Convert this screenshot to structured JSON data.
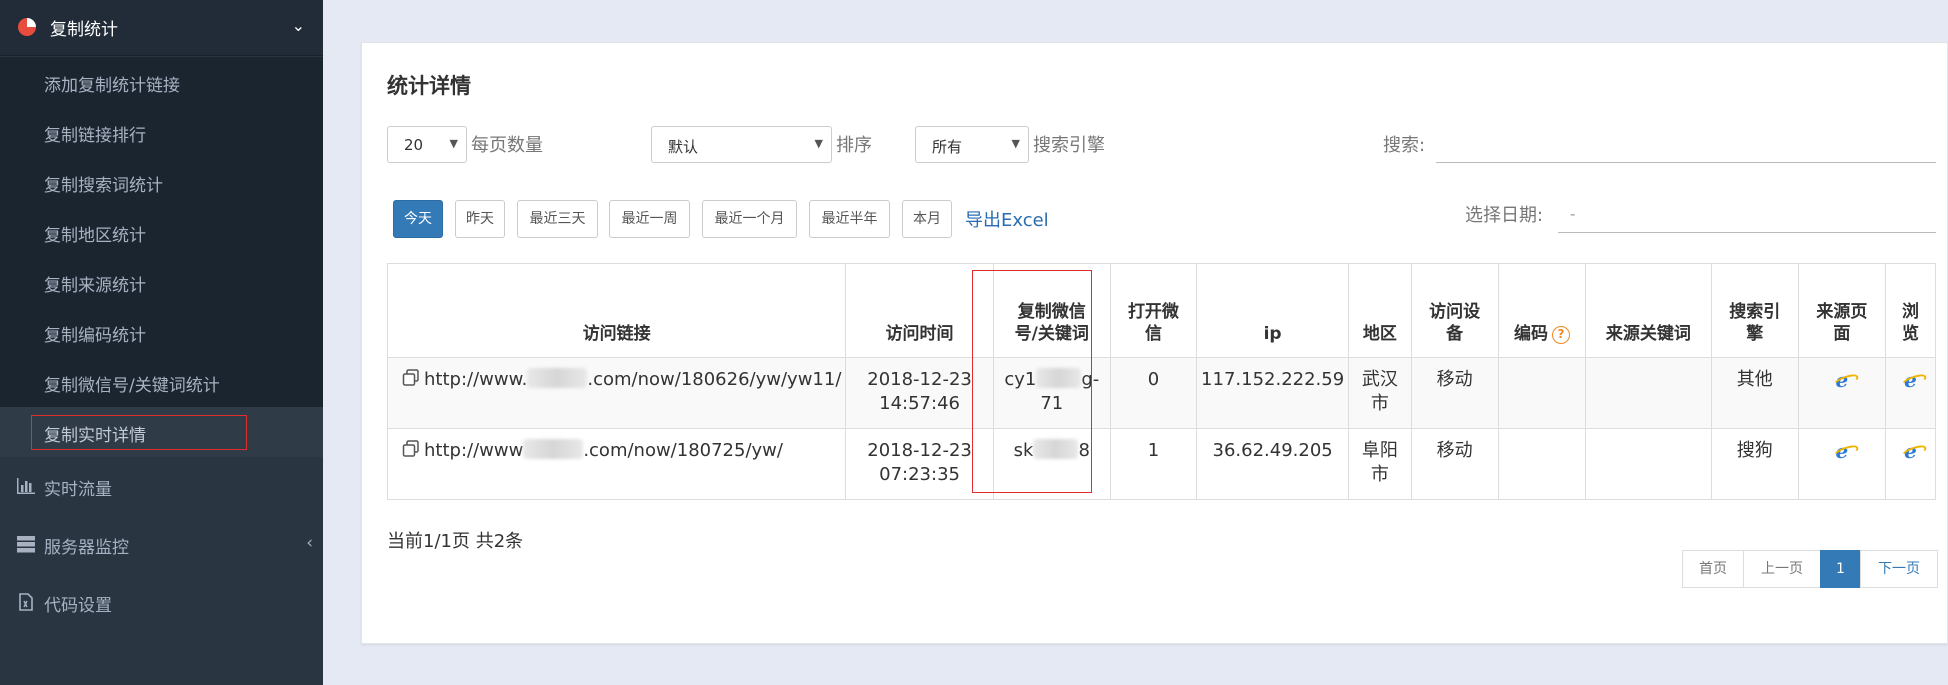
{
  "sidebar": {
    "header": {
      "title": "复制统计",
      "icon": "pie-chart-icon"
    },
    "submenu": [
      {
        "label": "添加复制统计链接"
      },
      {
        "label": "复制链接排行"
      },
      {
        "label": "复制搜索词统计"
      },
      {
        "label": "复制地区统计"
      },
      {
        "label": "复制来源统计"
      },
      {
        "label": "复制编码统计"
      },
      {
        "label": "复制微信号/关键词统计"
      },
      {
        "label": "复制实时详情"
      }
    ],
    "nav": [
      {
        "label": "实时流量",
        "icon": "bar-chart-icon"
      },
      {
        "label": "服务器监控",
        "icon": "server-icon"
      },
      {
        "label": "代码设置",
        "icon": "file-code-icon"
      }
    ]
  },
  "panel": {
    "title": "统计详情",
    "page_size": {
      "value": "20",
      "caption": "每页数量"
    },
    "sort": {
      "value": "默认",
      "caption": "排序"
    },
    "engine": {
      "value": "所有",
      "caption": "搜索引擎"
    },
    "search": {
      "caption": "搜索:",
      "value": ""
    },
    "date_buttons": [
      "今天",
      "昨天",
      "最近三天",
      "最近一周",
      "最近一个月",
      "最近半年",
      "本月"
    ],
    "export_label": "导出Excel",
    "date_picker": {
      "caption": "选择日期:",
      "value": "-"
    }
  },
  "table": {
    "headers": {
      "url": "访问链接",
      "time": "访问时间",
      "wechat_a": "复制微信",
      "wechat_b": "号/关键词",
      "open_a": "打开微",
      "open_b": "信",
      "ip": "ip",
      "region": "地区",
      "device_a": "访问设",
      "device_b": "备",
      "encoding": "编码",
      "source_kw": "来源关键词",
      "engine_a": "搜索引",
      "engine_b": "擎",
      "source_page_a": "来源页",
      "source_page_b": "面",
      "browse_a": "浏",
      "browse_b": "览"
    },
    "rows": [
      {
        "url_prefix": "http://www.",
        "url_suffix": ".com/now/180626/yw/yw11/",
        "date": "2018-12-23",
        "time": "14:57:46",
        "wechat_prefix": "cy1",
        "wechat_suffix": "g-",
        "wechat_line2": "71",
        "open": "0",
        "ip": "117.152.222.59",
        "region_a": "武汉",
        "region_b": "市",
        "device": "移动",
        "encoding": "",
        "source_kw": "",
        "engine": "其他"
      },
      {
        "url_prefix": "http://www",
        "url_suffix": ".com/now/180725/yw/",
        "date": "2018-12-23",
        "time": "07:23:35",
        "wechat_prefix": "sk",
        "wechat_suffix": "8",
        "wechat_line2": "",
        "open": "1",
        "ip": "36.62.49.205",
        "region_a": "阜阳",
        "region_b": "市",
        "device": "移动",
        "encoding": "",
        "source_kw": "",
        "engine": "搜狗"
      }
    ]
  },
  "footer": {
    "info": "当前1/1页 共2条",
    "pager": {
      "first": "首页",
      "prev": "上一页",
      "current": "1",
      "next": "下一页"
    }
  },
  "colors": {
    "sidebar": "#2a3542",
    "primary": "#337ab7",
    "highlight": "#e02d2d"
  }
}
